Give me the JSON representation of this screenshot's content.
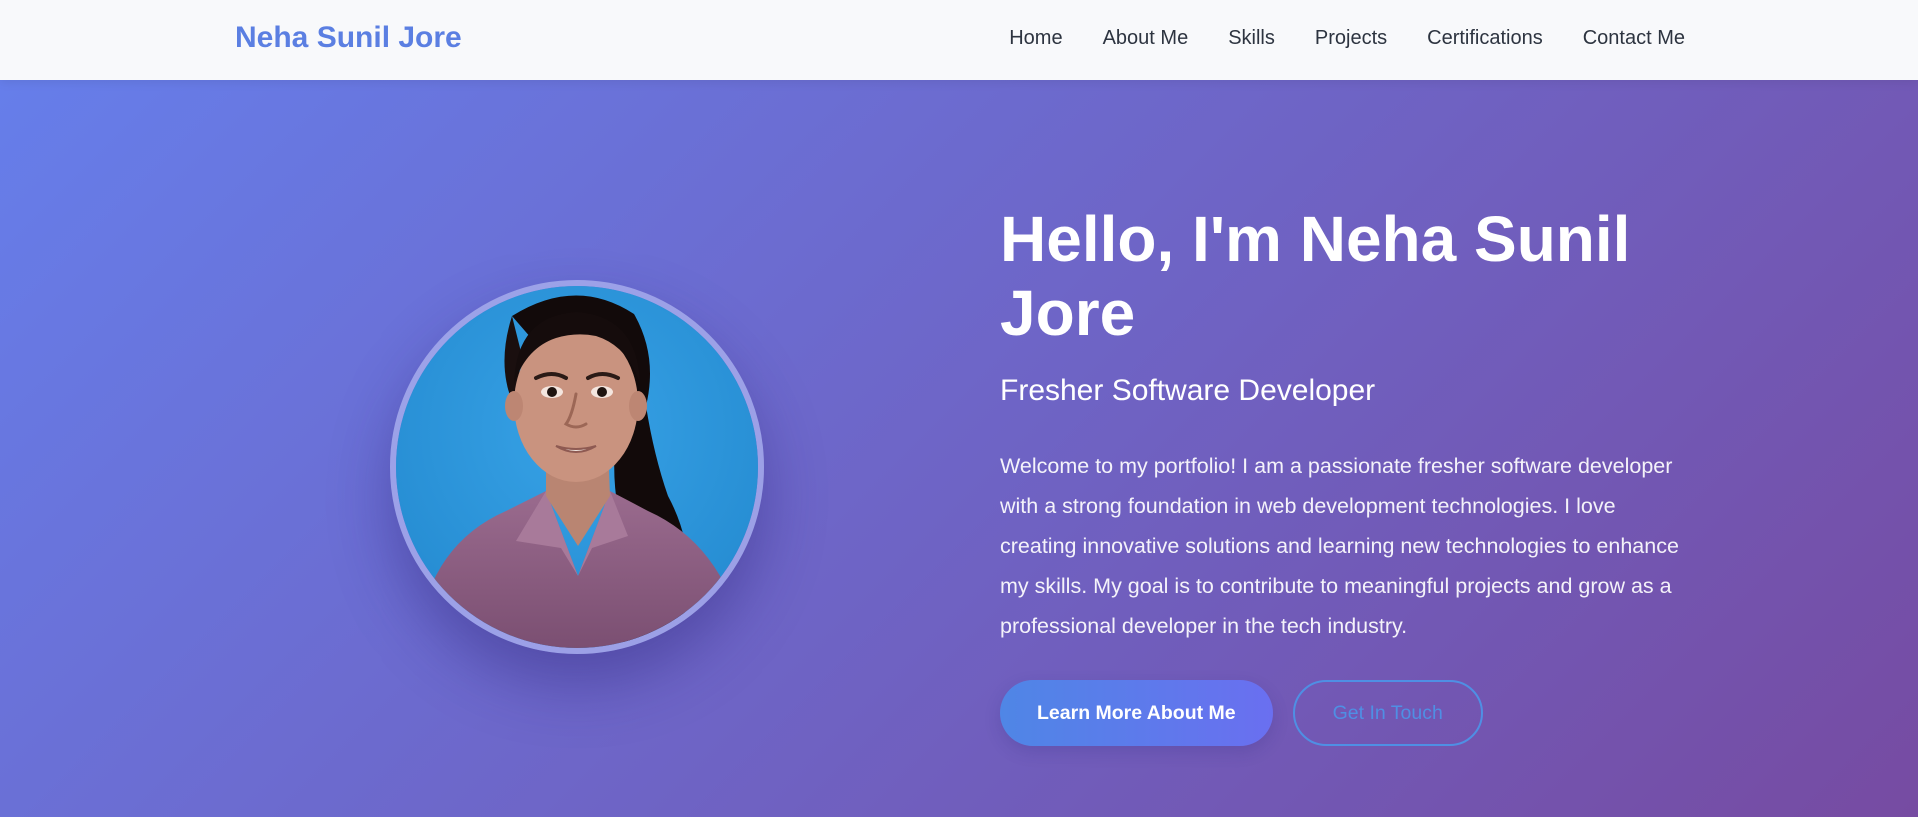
{
  "header": {
    "logo": "Neha Sunil Jore",
    "nav": [
      {
        "label": "Home"
      },
      {
        "label": "About Me"
      },
      {
        "label": "Skills"
      },
      {
        "label": "Projects"
      },
      {
        "label": "Certifications"
      },
      {
        "label": "Contact Me"
      }
    ]
  },
  "hero": {
    "title": "Hello, I'm Neha Sunil Jore",
    "subtitle": "Fresher Software Developer",
    "description": "Welcome to my portfolio! I am a passionate fresher software developer with a strong foundation in web development technologies. I love creating innovative solutions and learning new technologies to enhance my skills. My goal is to contribute to meaningful projects and grow as a professional developer in the tech industry.",
    "primary_button": "Learn More About Me",
    "secondary_button": "Get In Touch",
    "photo_alt": "profile photo"
  },
  "colors": {
    "logo": "#5b7fe2",
    "gradient_start": "#667eea",
    "gradient_end": "#764ba2",
    "primary_button": "#5a7ee8",
    "secondary_outline": "#4f8fe4",
    "navbar_bg": "#f8f9fb"
  }
}
